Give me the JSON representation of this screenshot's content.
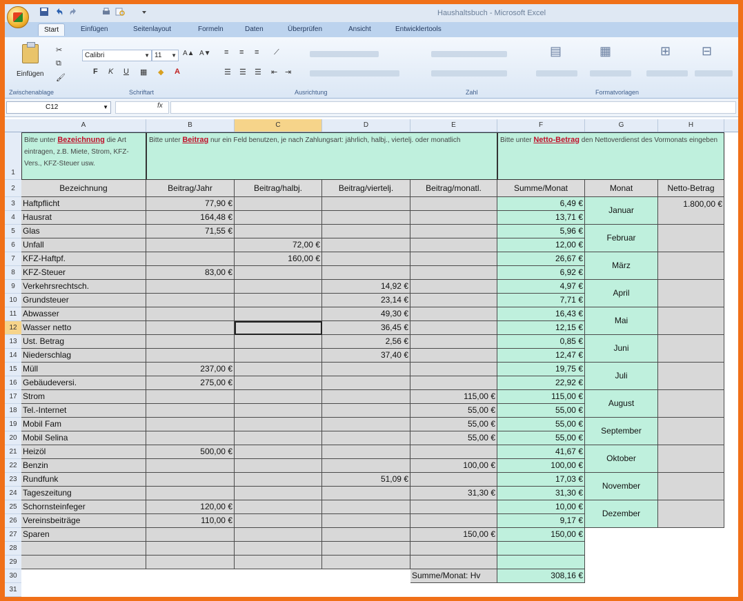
{
  "window": {
    "title": "Haushaltsbuch - Microsoft Excel"
  },
  "ribbon": {
    "tabs": [
      "Start",
      "Einfügen",
      "Seitenlayout",
      "Formeln",
      "Daten",
      "Überprüfen",
      "Ansicht",
      "Entwicklertools"
    ],
    "paste_label": "Einfügen",
    "font_name": "Calibri",
    "font_size": "11",
    "groups": [
      "Zwischenablage",
      "Schriftart",
      "Ausrichtung",
      "Zahl",
      "Formatvorlagen"
    ]
  },
  "formula_bar": {
    "cell_ref": "C12",
    "fx": "fx",
    "formula": ""
  },
  "grid": {
    "columns": [
      "A",
      "B",
      "C",
      "D",
      "E",
      "F",
      "G",
      "H"
    ],
    "rows": [
      "1",
      "2",
      "3",
      "4",
      "5",
      "6",
      "7",
      "8",
      "9",
      "10",
      "11",
      "12",
      "13",
      "14",
      "15",
      "16",
      "17",
      "18",
      "19",
      "20",
      "21",
      "22",
      "23",
      "24",
      "25",
      "26",
      "27",
      "28",
      "29",
      "30",
      "31"
    ],
    "notes": {
      "a1_pre": "Bitte unter ",
      "a1_bold": "Bezeichnung",
      "a1_post": " die Art eintragen, z.B. Miete, Strom, KFZ-Vers., KFZ-Steuer usw.",
      "b1_pre": "Bitte unter ",
      "b1_bold": "Beitrag",
      "b1_post": " nur ein Feld benutzen, je nach Zahlungsart: jährlich, halbj., viertelj. oder monatlich",
      "f1_pre": "Bitte unter ",
      "f1_bold": "Netto-Betrag",
      "f1_post": " den Nettoverdienst des Vormonats eingeben"
    },
    "headers": [
      "Bezeichnung",
      "Beitrag/Jahr",
      "Beitrag/halbj.",
      "Beitrag/viertelj.",
      "Beitrag/monatl.",
      "Summe/Monat",
      "Monat",
      "Netto-Betrag"
    ],
    "rows_data": [
      {
        "a": "Haftpflicht",
        "b": "77,90 €",
        "c": "",
        "d": "",
        "e": "",
        "f": "6,49 €"
      },
      {
        "a": "Hausrat",
        "b": "164,48 €",
        "c": "",
        "d": "",
        "e": "",
        "f": "13,71 €"
      },
      {
        "a": "Glas",
        "b": "71,55 €",
        "c": "",
        "d": "",
        "e": "",
        "f": "5,96 €"
      },
      {
        "a": "Unfall",
        "b": "",
        "c": "72,00 €",
        "d": "",
        "e": "",
        "f": "12,00 €"
      },
      {
        "a": "KFZ-Haftpf.",
        "b": "",
        "c": "160,00 €",
        "d": "",
        "e": "",
        "f": "26,67 €"
      },
      {
        "a": "KFZ-Steuer",
        "b": "83,00 €",
        "c": "",
        "d": "",
        "e": "",
        "f": "6,92 €"
      },
      {
        "a": "Verkehrsrechtsch.",
        "b": "",
        "c": "",
        "d": "14,92 €",
        "e": "",
        "f": "4,97 €"
      },
      {
        "a": "Grundsteuer",
        "b": "",
        "c": "",
        "d": "23,14 €",
        "e": "",
        "f": "7,71 €"
      },
      {
        "a": "Abwasser",
        "b": "",
        "c": "",
        "d": "49,30 €",
        "e": "",
        "f": "16,43 €"
      },
      {
        "a": "Wasser netto",
        "b": "",
        "c": "",
        "d": "36,45 €",
        "e": "",
        "f": "12,15 €"
      },
      {
        "a": "Ust. Betrag",
        "b": "",
        "c": "",
        "d": "2,56 €",
        "e": "",
        "f": "0,85 €"
      },
      {
        "a": "Niederschlag",
        "b": "",
        "c": "",
        "d": "37,40 €",
        "e": "",
        "f": "12,47 €"
      },
      {
        "a": "Müll",
        "b": "237,00 €",
        "c": "",
        "d": "",
        "e": "",
        "f": "19,75 €"
      },
      {
        "a": "Gebäudeversi.",
        "b": "275,00 €",
        "c": "",
        "d": "",
        "e": "",
        "f": "22,92 €"
      },
      {
        "a": "Strom",
        "b": "",
        "c": "",
        "d": "",
        "e": "115,00 €",
        "f": "115,00 €"
      },
      {
        "a": "Tel.-Internet",
        "b": "",
        "c": "",
        "d": "",
        "e": "55,00 €",
        "f": "55,00 €"
      },
      {
        "a": "Mobil Fam",
        "b": "",
        "c": "",
        "d": "",
        "e": "55,00 €",
        "f": "55,00 €"
      },
      {
        "a": "Mobil Selina",
        "b": "",
        "c": "",
        "d": "",
        "e": "55,00 €",
        "f": "55,00 €"
      },
      {
        "a": "Heizöl",
        "b": "500,00 €",
        "c": "",
        "d": "",
        "e": "",
        "f": "41,67 €"
      },
      {
        "a": "Benzin",
        "b": "",
        "c": "",
        "d": "",
        "e": "100,00 €",
        "f": "100,00 €"
      },
      {
        "a": "Rundfunk",
        "b": "",
        "c": "",
        "d": "51,09 €",
        "e": "",
        "f": "17,03 €"
      },
      {
        "a": "Tageszeitung",
        "b": "",
        "c": "",
        "d": "",
        "e": "31,30 €",
        "f": "31,30 €"
      },
      {
        "a": "Schornsteinfeger",
        "b": "120,00 €",
        "c": "",
        "d": "",
        "e": "",
        "f": "10,00 €"
      },
      {
        "a": "Vereinsbeiträge",
        "b": "110,00 €",
        "c": "",
        "d": "",
        "e": "",
        "f": "9,17 €"
      },
      {
        "a": "Sparen",
        "b": "",
        "c": "",
        "d": "",
        "e": "150,00 €",
        "f": "150,00 €"
      },
      {
        "a": "",
        "b": "",
        "c": "",
        "d": "",
        "e": "",
        "f": ""
      },
      {
        "a": "",
        "b": "",
        "c": "",
        "d": "",
        "e": "",
        "f": ""
      }
    ],
    "total_label": "Summe/Monat: Hv",
    "total_value": "308,16 €",
    "months": [
      "Januar",
      "Februar",
      "März",
      "April",
      "Mai",
      "Juni",
      "Juli",
      "August",
      "September",
      "Oktober",
      "November",
      "Dezember"
    ],
    "netto": [
      "1.800,00 €",
      "",
      "",
      "",
      "",
      "",
      "",
      "",
      "",
      "",
      "",
      ""
    ]
  },
  "colors": {
    "frame": "#f07018",
    "green": "#bff0dd",
    "gray": "#d8d8d8",
    "accent_text": "#c0102a"
  }
}
